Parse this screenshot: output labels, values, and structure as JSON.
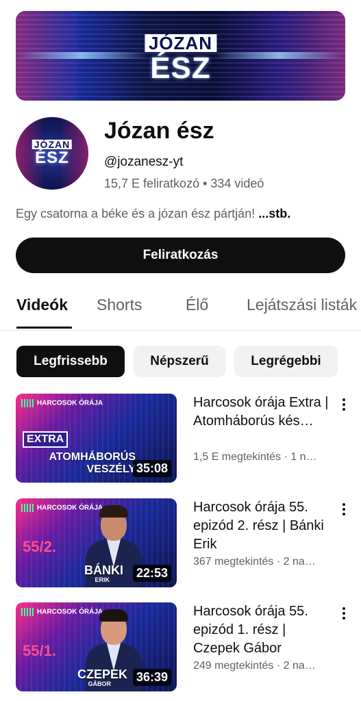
{
  "banner": {
    "logo_top": "JÓZAN",
    "logo_bottom": "ÉSZ"
  },
  "avatar": {
    "logo_top": "JÓZAN",
    "logo_bottom": "ÉSZ"
  },
  "channel": {
    "name": "Józan ész",
    "handle": "@jozanesz-yt",
    "stats": "15,7 E feliratkozó • 334 videó",
    "description": "Egy csatorna a béke és a józan ész pártján! ",
    "description_more": "...stb."
  },
  "subscribe_label": "Feliratkozás",
  "tabs": [
    {
      "label": "Videók"
    },
    {
      "label": "Shorts"
    },
    {
      "label": "Élő"
    },
    {
      "label": "Lejátszási listák"
    }
  ],
  "chips": [
    {
      "label": "Legfrissebb"
    },
    {
      "label": "Népszerű"
    },
    {
      "label": "Legrégebbi"
    }
  ],
  "videos": [
    {
      "title": "Harcosok órája Extra | Atomháborús kés…",
      "meta": "1,5 E megtekintés · 1 n…",
      "duration": "35:08",
      "brand": "HARCOSOK ÓRÁJA",
      "tag": "EXTRA",
      "thumb_line1": "ATOMHÁBORÚS",
      "thumb_line2": "VESZÉLY"
    },
    {
      "title": "Harcosok órája 55. epizód 2. rész | Bánki Erik",
      "meta": "367 megtekintés · 2 na…",
      "duration": "22:53",
      "brand": "HARCOSOK ÓRÁJA",
      "episode": "55/2.",
      "thumb_line1": "BÁNKI",
      "thumb_line2": "ERIK"
    },
    {
      "title": "Harcosok órája 55. epizód 1. rész | Czepek Gábor",
      "meta": "249 megtekintés · 2 na…",
      "duration": "36:39",
      "brand": "HARCOSOK ÓRÁJA",
      "episode": "55/1.",
      "thumb_line1": "CZEPEK",
      "thumb_line2": "GÁBOR"
    }
  ],
  "colors": {
    "accent": "#0f0f0f",
    "secondary_text": "#606060",
    "chip_bg": "#f2f2f2"
  },
  "icons": {
    "kebab": "more-vert-icon"
  }
}
